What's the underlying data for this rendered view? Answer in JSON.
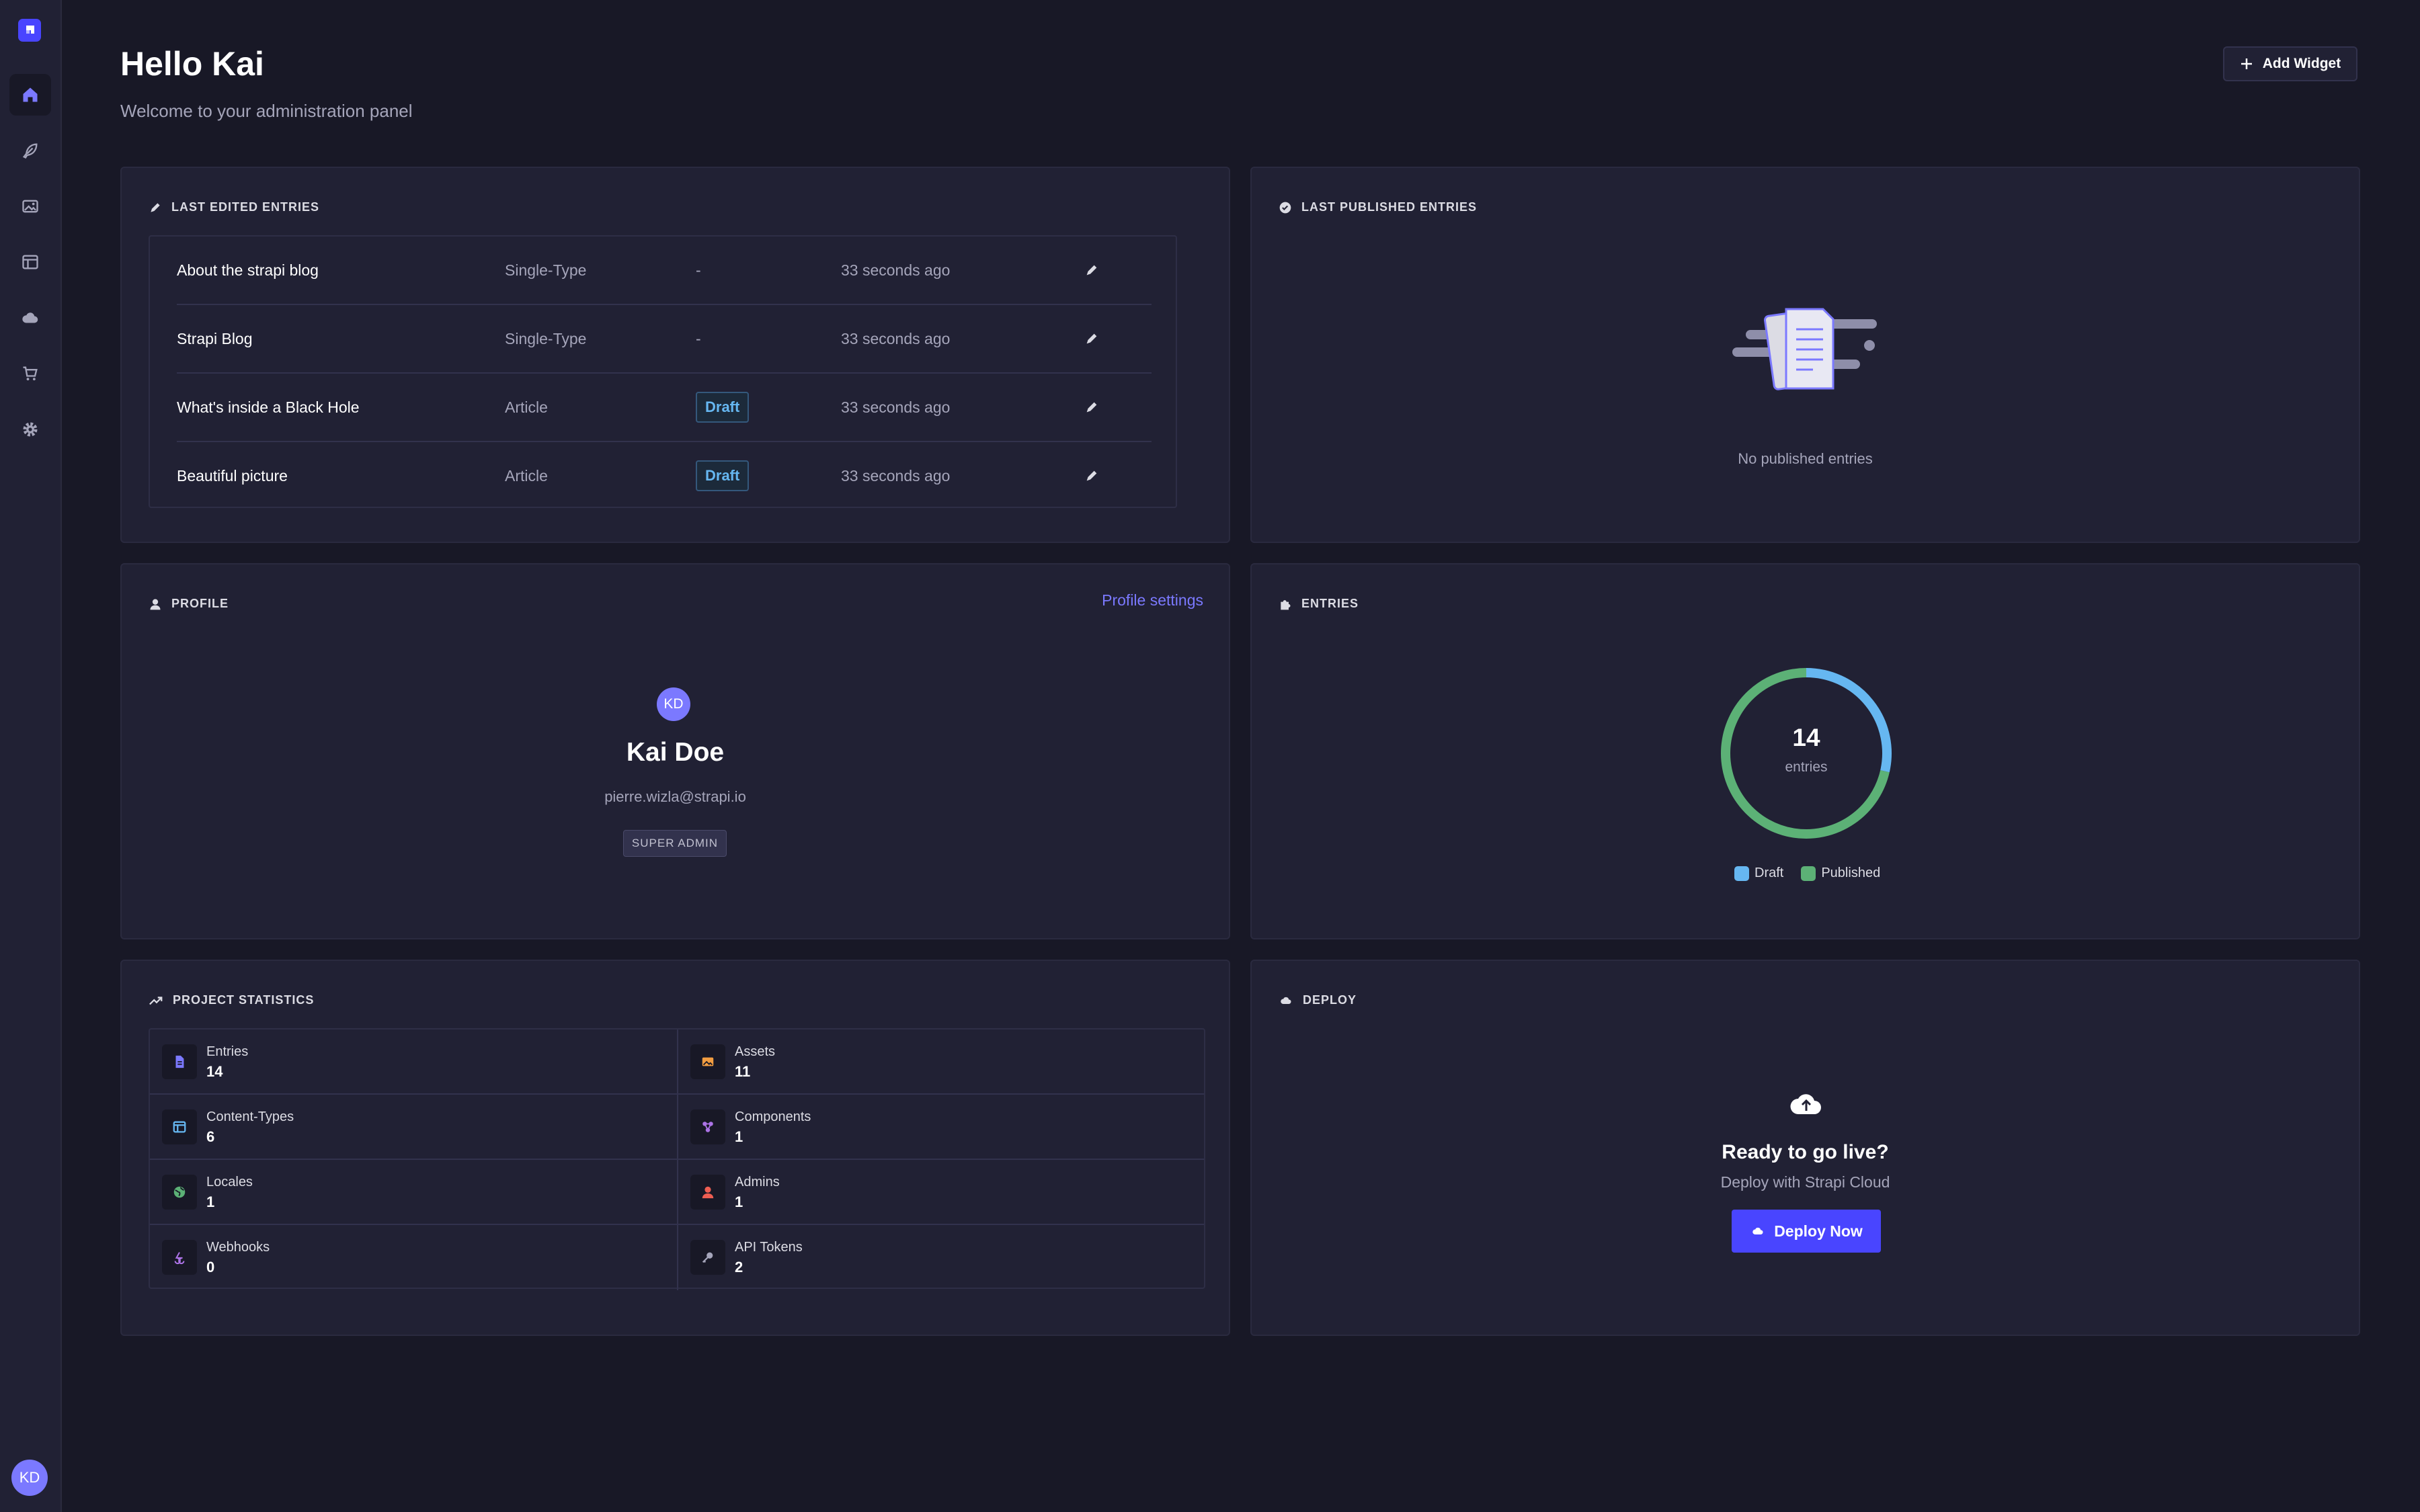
{
  "header": {
    "greeting": "Hello Kai",
    "subtitle": "Welcome to your administration panel",
    "add_widget_label": "Add Widget"
  },
  "sidebar": {
    "items": [
      {
        "name": "home",
        "icon": "home-icon",
        "active": true
      },
      {
        "name": "content-manager",
        "icon": "feather-icon"
      },
      {
        "name": "media-library",
        "icon": "image-icon"
      },
      {
        "name": "content-type-builder",
        "icon": "layout-icon"
      },
      {
        "name": "deploy",
        "icon": "cloud-icon"
      },
      {
        "name": "marketplace",
        "icon": "cart-icon"
      },
      {
        "name": "settings",
        "icon": "gear-icon"
      }
    ],
    "user_initials": "KD"
  },
  "last_edited": {
    "title": "Last edited entries",
    "rows": [
      {
        "title": "About the strapi blog",
        "type": "Single-Type",
        "status": "-",
        "time": "33 seconds ago"
      },
      {
        "title": "Strapi Blog",
        "type": "Single-Type",
        "status": "-",
        "time": "33 seconds ago"
      },
      {
        "title": "What's inside a Black Hole",
        "type": "Article",
        "status": "Draft",
        "time": "33 seconds ago"
      },
      {
        "title": "Beautiful picture",
        "type": "Article",
        "status": "Draft",
        "time": "33 seconds ago"
      }
    ]
  },
  "last_published": {
    "title": "Last published entries",
    "empty_text": "No published entries"
  },
  "profile": {
    "title": "Profile",
    "settings_link": "Profile settings",
    "initials": "KD",
    "name": "Kai Doe",
    "email": "pierre.wizla@strapi.io",
    "role": "SUPER ADMIN"
  },
  "entries_widget": {
    "title": "Entries",
    "total": "14",
    "unit": "entries"
  },
  "chart_data": {
    "type": "pie",
    "total": 14,
    "categories": [
      "Draft",
      "Published"
    ],
    "values": [
      4,
      10
    ],
    "colors": [
      "#66b7f1",
      "#5cb176"
    ],
    "legend_position": "bottom"
  },
  "project_stats": {
    "title": "Project statistics",
    "items": [
      {
        "label": "Entries",
        "value": "14",
        "icon": "file-icon",
        "color": "#7b79ff"
      },
      {
        "label": "Assets",
        "value": "11",
        "icon": "image-icon",
        "color": "#f29d41"
      },
      {
        "label": "Content-Types",
        "value": "6",
        "icon": "layout-icon",
        "color": "#66b7f1"
      },
      {
        "label": "Components",
        "value": "1",
        "icon": "puzzle-icon",
        "color": "#ac73e6"
      },
      {
        "label": "Locales",
        "value": "1",
        "icon": "globe-icon",
        "color": "#5cb176"
      },
      {
        "label": "Admins",
        "value": "1",
        "icon": "user-icon",
        "color": "#ee5e52"
      },
      {
        "label": "Webhooks",
        "value": "0",
        "icon": "webhook-icon",
        "color": "#ac73e6"
      },
      {
        "label": "API Tokens",
        "value": "2",
        "icon": "key-icon",
        "color": "#a5a5ba"
      }
    ]
  },
  "deploy": {
    "title": "Deploy",
    "heading": "Ready to go live?",
    "subtitle": "Deploy with Strapi Cloud",
    "button_label": "Deploy Now"
  },
  "colors": {
    "background": "#181826",
    "card": "#212134",
    "accent": "#4945ff",
    "link": "#7b79ff"
  }
}
